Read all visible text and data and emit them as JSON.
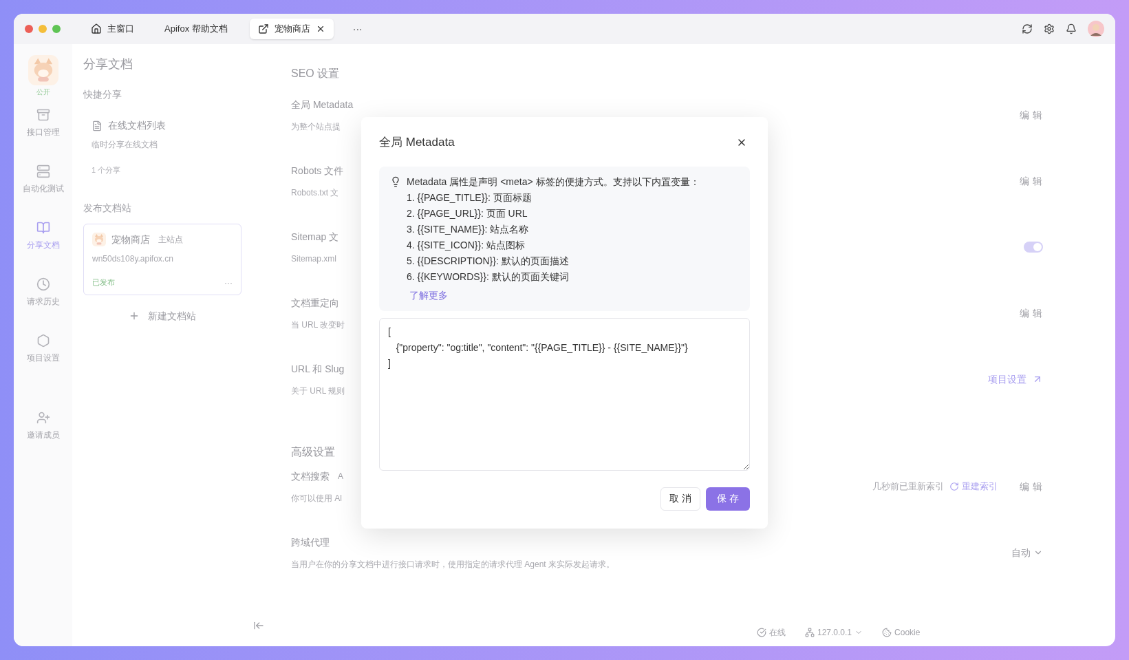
{
  "tabs": [
    {
      "label": "主窗口",
      "selected": false
    },
    {
      "label": "Apifox 帮助文档",
      "selected": false
    },
    {
      "label": "宠物商店",
      "selected": true
    }
  ],
  "tabs_more": "···",
  "nav": {
    "avatar_label": "公开",
    "items": [
      {
        "label": "接口管理",
        "selected": false
      },
      {
        "label": "自动化测试",
        "selected": false
      },
      {
        "label": "分享文档",
        "selected": true
      },
      {
        "label": "请求历史",
        "selected": false
      },
      {
        "label": "项目设置",
        "selected": false
      },
      {
        "label": "邀请成员",
        "selected": false
      }
    ]
  },
  "share_panel": {
    "title": "分享文档",
    "quick_title": "快捷分享",
    "quick_item": {
      "label": "在线文档列表",
      "description": "临时分享在线文档",
      "count": "1 个分享"
    },
    "sites_title": "发布文档站",
    "site": {
      "name": "宠物商店",
      "tag": "主站点",
      "url": "wn50ds108y.apifox.cn",
      "status": "已发布",
      "more": "···"
    },
    "new_site": "新建文档站"
  },
  "seo": {
    "title": "SEO 设置",
    "rows": [
      {
        "kind": "edit",
        "label": "全局 Metadata",
        "description": "为整个站点提",
        "action": "编 辑"
      },
      {
        "kind": "edit",
        "label": "Robots 文件",
        "description": "Robots.txt 文",
        "action": "编 辑"
      },
      {
        "kind": "toggle",
        "label": "Sitemap 文",
        "description": "Sitemap.xml",
        "on": true
      },
      {
        "kind": "edit",
        "label": "文档重定向",
        "description": "当 URL 改变时",
        "action": "编 辑"
      },
      {
        "kind": "link",
        "label": "URL 和 Slug",
        "description": "关于 URL 规则",
        "action": "项目设置"
      }
    ]
  },
  "advanced": {
    "title": "高级设置",
    "rows": [
      {
        "kind": "search",
        "label": "文档搜索",
        "tag": "A",
        "description": "你可以使用 Al",
        "status": "几秒前已重新索引",
        "reindex": "重建索引",
        "action": "编 辑"
      },
      {
        "kind": "select",
        "label": "跨域代理",
        "description": "当用户在你的分享文档中进行接口请求时，使用指定的请求代理 Agent 来实际发起请求。",
        "value": "自动"
      }
    ]
  },
  "status_bar": [
    {
      "kind": "online",
      "label": "在线"
    },
    {
      "kind": "server",
      "label": "127.0.0.1"
    },
    {
      "kind": "cookie",
      "label": "Cookie"
    }
  ],
  "dialog": {
    "title": "全局 Metadata",
    "info": "Metadata 属性是声明 <meta> 标签的便捷方式。支持以下内置变量：",
    "variables": [
      "1. {{PAGE_TITLE}}: 页面标题",
      "2. {{PAGE_URL}}: 页面 URL",
      "3. {{SITE_NAME}}: 站点名称",
      "4. {{SITE_ICON}}: 站点图标",
      "5. {{DESCRIPTION}}: 默认的页面描述",
      "6. {{KEYWORDS}}: 默认的页面关键词"
    ],
    "learn_more": "了解更多",
    "value": "[\n   {\"property\": \"og:title\", \"content\": \"{{PAGE_TITLE}} - {{SITE_NAME}}\"}\n]",
    "cancel": "取 消",
    "save": "保 存"
  }
}
